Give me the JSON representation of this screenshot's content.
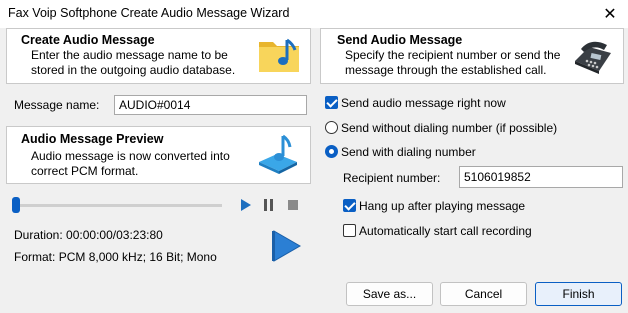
{
  "window": {
    "title": "Fax Voip Softphone Create Audio Message Wizard",
    "close_label": "✕"
  },
  "create": {
    "title": "Create Audio Message",
    "line1": "Enter the audio message name to be",
    "line2": "stored in the outgoing audio database."
  },
  "message_name": {
    "label": "Message name:",
    "value": "AUDIO#0014"
  },
  "preview": {
    "title": "Audio Message Preview",
    "line1": "Audio message is now converted into",
    "line2": "correct PCM format."
  },
  "player": {
    "progress": 0.0
  },
  "duration": {
    "label": "Duration:",
    "value": "00:00:00/03:23:80"
  },
  "format": {
    "label": "Format:",
    "value": "PCM 8,000 kHz; 16 Bit; Mono"
  },
  "send": {
    "title": "Send Audio Message",
    "line1": "Specify the recipient number or send the",
    "line2": "message through the established call."
  },
  "options": {
    "send_now": {
      "label": "Send audio message right now",
      "checked": true
    },
    "without_dialing": {
      "label": "Send without dialing number (if possible)",
      "selected": false
    },
    "with_dialing": {
      "label": "Send with dialing number",
      "selected": true
    }
  },
  "recipient": {
    "label": "Recipient number:",
    "value": "5106019852"
  },
  "hangup": {
    "label": "Hang up after playing message",
    "checked": true
  },
  "auto_record": {
    "label": "Automatically start call recording",
    "checked": false
  },
  "buttons": {
    "save_as": "Save as...",
    "cancel": "Cancel",
    "finish": "Finish"
  },
  "colors": {
    "accent": "#0a5fc4",
    "folder": "#f5c842",
    "note": "#2b8fd6"
  }
}
